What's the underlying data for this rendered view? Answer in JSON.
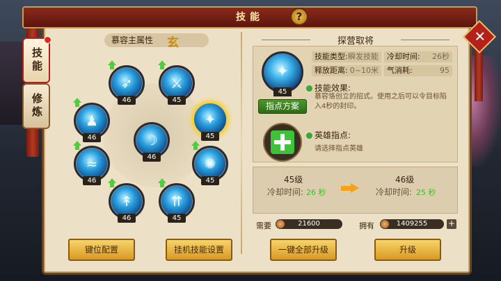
{
  "window": {
    "title": "技能",
    "help_label": "?",
    "close_label": "✕"
  },
  "tabs": [
    {
      "label": "技能",
      "active": true,
      "notification": true
    },
    {
      "label": "修炼",
      "active": false
    }
  ],
  "left": {
    "attribute_label": "慕容主属性",
    "attribute_value": "玄",
    "skills": [
      {
        "level": "46",
        "icon": "ice-blade-icon",
        "upgradable": true
      },
      {
        "level": "45",
        "icon": "sword-icon",
        "upgradable": true
      },
      {
        "level": "46",
        "icon": "warrior-aura-icon",
        "upgradable": true
      },
      {
        "level": "45",
        "icon": "frozen-figure-icon",
        "upgradable": false,
        "selected": true
      },
      {
        "level": "46",
        "icon": "ice-slash-icon",
        "upgradable": false
      },
      {
        "level": "46",
        "icon": "water-spirit-icon",
        "upgradable": true
      },
      {
        "level": "45",
        "icon": "ice-burst-icon",
        "upgradable": true
      },
      {
        "level": "46",
        "icon": "ice-spear-icon",
        "upgradable": true
      },
      {
        "level": "45",
        "icon": "triple-spear-icon",
        "upgradable": true
      }
    ]
  },
  "detail": {
    "section_title": "探营取将",
    "icon_level": "45",
    "plan_button": "指点方案",
    "skill_type_label": "技能类型:",
    "skill_type_value": "瞬发技能",
    "cooldown_label": "冷却时间:",
    "cooldown_value": "26秒",
    "range_label": "释放距离:",
    "range_value": "0~10米",
    "mana_label": "气消耗:",
    "mana_value": "95",
    "effect_title": "技能效果:",
    "effect_text": "慕容恪创立的招式。使用之后可以令目标陷入4秒的封印。",
    "hint_title": "英雄指点:",
    "hint_text": "请选择指点英雄"
  },
  "cooldown_compare": {
    "current_level": "45级",
    "next_level": "46级",
    "label": "冷却时间:",
    "current_value": "26 秒",
    "next_value": "25 秒"
  },
  "resources": {
    "need_label": "需要",
    "need_value": "21600",
    "have_label": "拥有",
    "have_value": "1409255",
    "add_label": "+"
  },
  "buttons": {
    "keybind": "键位配置",
    "auto_skill": "挂机技能设置",
    "upgrade_all": "一键全部升级",
    "upgrade": "升级"
  },
  "colors": {
    "accent_green": "#3cbf2a",
    "title_red": "#8a2a1c",
    "button_gold": "#d99a22"
  }
}
